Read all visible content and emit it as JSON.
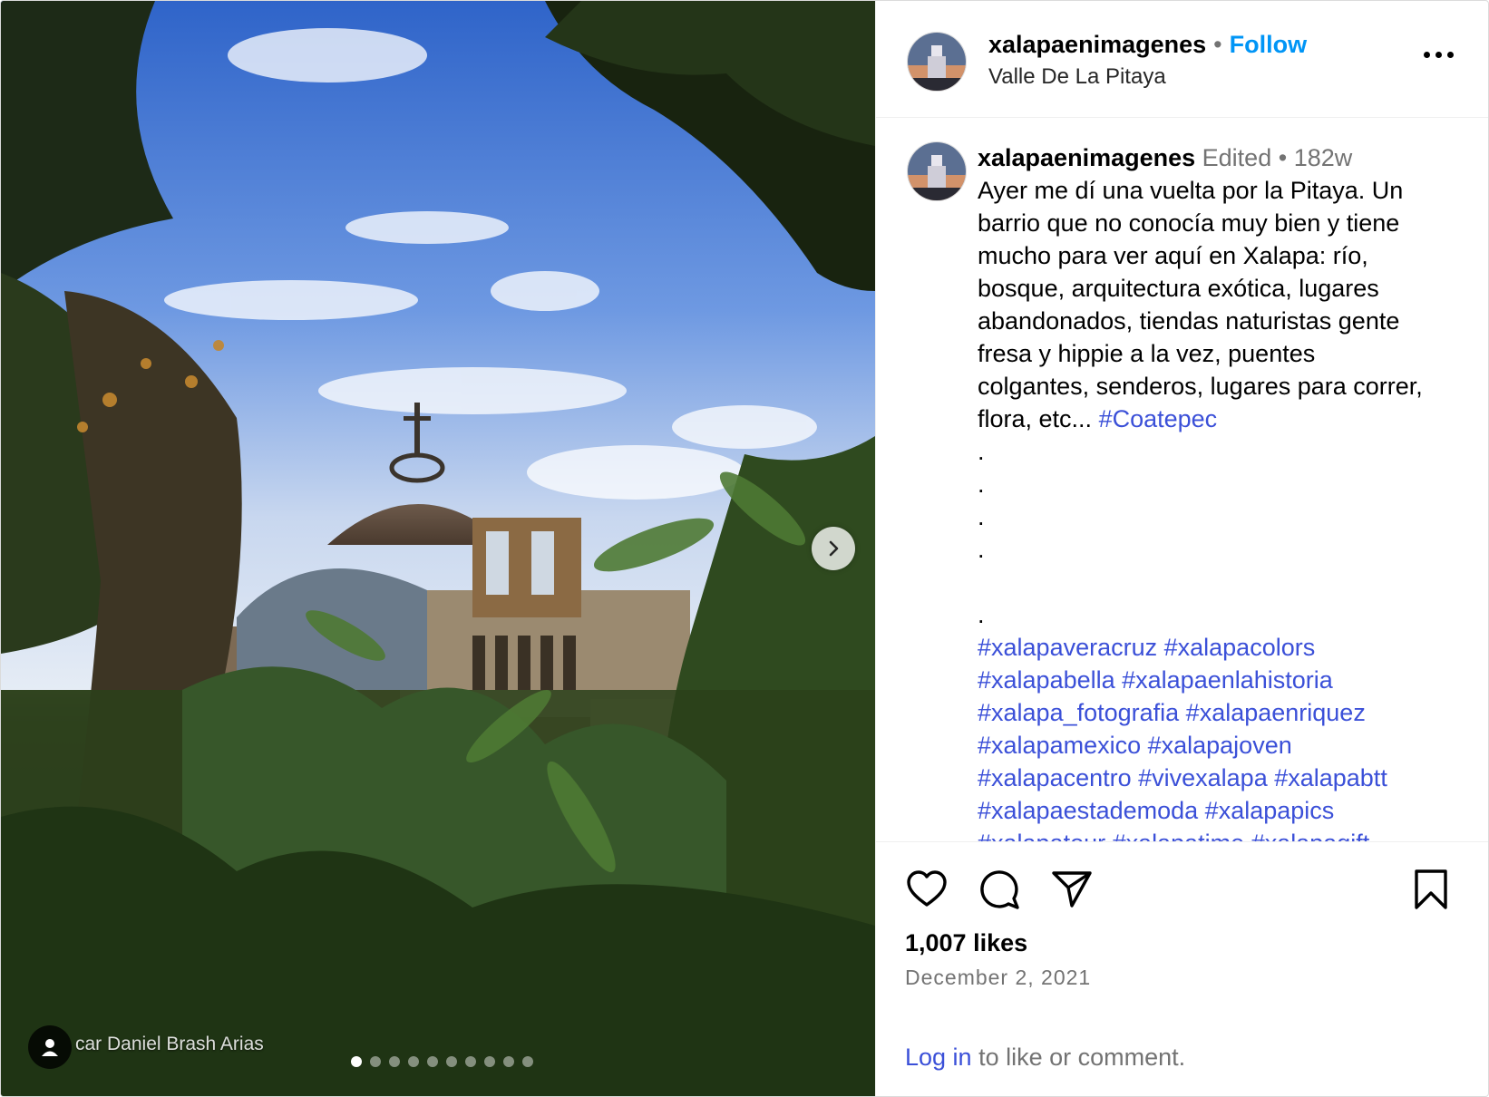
{
  "post": {
    "username": "xalapaenimagenes",
    "follow_label": "Follow",
    "location": "Valle De La Pitaya",
    "separator": "•"
  },
  "media": {
    "tag_credit": "car Daniel Brash Arias",
    "carousel_count": 10,
    "active_index": 0
  },
  "caption": {
    "username": "xalapaenimagenes",
    "edited": "Edited",
    "separator": "•",
    "age": "182w",
    "text": "Ayer me dí una vuelta por la Pitaya. Un barrio que no conocía muy bien y tiene mucho para ver aquí en Xalapa: río, bosque, arquitectura exótica, lugares abandonados, tiendas naturistas gente fresa y hippie a la vez, puentes colgantes, senderos, lugares para correr, flora, etc...",
    "inline_tag": "#Coatepec",
    "dot": ".",
    "hashtag_lines": [
      "#xalapaveracruz #xalapacolors",
      "#xalapabella #xalapaenlahistoria",
      "#xalapa_fotografia #xalapaenriquez",
      "#xalapamexico #xalapajoven",
      "#xalapacentro #vivexalapa #xalapabtt",
      "#xalapaestademoda #xalapapics",
      "#xalapatour #xalapatime #xalapagift"
    ]
  },
  "footer": {
    "likes": "1,007 likes",
    "date": "December 2, 2021",
    "login_link": "Log in",
    "login_rest": " to like or comment."
  },
  "icons": {
    "like": "heart-icon",
    "comment": "comment-icon",
    "share": "paper-plane-icon",
    "save": "bookmark-icon",
    "more": "more-options-icon",
    "next": "chevron-right-icon",
    "tag": "user-tag-icon"
  },
  "colors": {
    "link": "#3b50d8",
    "follow": "#0095f6",
    "muted": "#737373"
  }
}
